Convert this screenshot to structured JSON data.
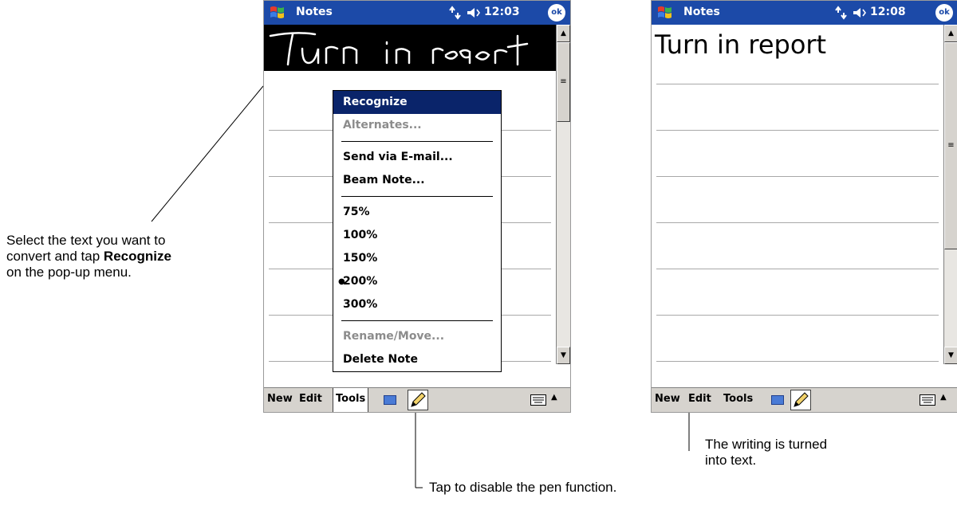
{
  "callouts": {
    "select_line1": "Select the text you want to",
    "select_line2_a": "convert and tap ",
    "select_line2_b": "Recognize",
    "select_line3": "on the pop-up menu.",
    "pen_text": "Tap to disable the pen function.",
    "writing_line1": "The writing is turned",
    "writing_line2": "into text."
  },
  "left_screen": {
    "title": "Notes",
    "clock": "12:03",
    "ok_label": "ok",
    "menubar": {
      "new": "New",
      "edit": "Edit",
      "tools": "Tools"
    },
    "popup": {
      "recognize": "Recognize",
      "alternates": "Alternates...",
      "send_email": "Send via E-mail...",
      "beam": "Beam Note...",
      "z75": "75%",
      "z100": "100%",
      "z150": "150%",
      "z200": "200%",
      "z300": "300%",
      "rename": "Rename/Move...",
      "delete": "Delete Note",
      "selected_zoom": "200%"
    }
  },
  "right_screen": {
    "title": "Notes",
    "clock": "12:08",
    "ok_label": "ok",
    "note_text": "Turn in report",
    "menubar": {
      "new": "New",
      "edit": "Edit",
      "tools": "Tools"
    }
  },
  "icons": {
    "start": "windows-flag-icon",
    "connectivity": "connectivity-icon",
    "speaker": "speaker-icon",
    "ok": "ok-button",
    "recorder": "recorder-icon",
    "pen": "pen-icon",
    "keyboard": "keyboard-icon",
    "sip": "sip-arrow-icon"
  },
  "colors": {
    "titlebar": "#1c4aa8",
    "menu_highlight": "#0a246a",
    "disabled": "#8c8c8c"
  }
}
